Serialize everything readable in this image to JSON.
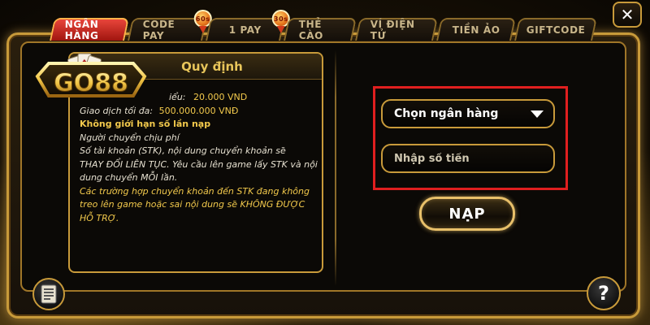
{
  "tabs": [
    {
      "label": "NGÂN HÀNG",
      "active": true
    },
    {
      "label": "CODE PAY",
      "badge": "60s"
    },
    {
      "label": "1 PAY",
      "badge": "30s"
    },
    {
      "label": "THẺ CÀO"
    },
    {
      "label": "VÍ ĐIỆN TỬ"
    },
    {
      "label": "TIỀN ẢO"
    },
    {
      "label": "GIFTCODE"
    }
  ],
  "close_label": "✕",
  "logo_text": "GO88",
  "rules": {
    "title": "Quy định",
    "min_suffix": "iểu:",
    "min_value": "20.000 VND",
    "max_label": "Giao dịch tối đa:",
    "max_value": "500.000.000 VNĐ",
    "unlimited": "Không giới hạn số  lần nạp",
    "fee": "Người chuyển chịu phí",
    "line1": "Số tài khoản (STK), nội dung chuyển khoản sẽ",
    "line2": "THAY ĐỔI LIÊN TỤC. Yêu cầu lên game lấy STK và nội",
    "line3": "dung chuyển MỖI lần.",
    "line4": "Các trường hợp chuyển khoản đến STK đang không",
    "line5": "treo lên game hoặc sai nội dung sẽ KHÔNG ĐƯỢC",
    "line6": "HỖ TRỢ."
  },
  "form": {
    "bank_select_label": "Chọn ngân hàng",
    "amount_placeholder": "Nhập số tiền",
    "submit_label": "NẠP"
  },
  "help_label": "?",
  "colors": {
    "accent_gold": "#c89a3a",
    "active_tab": "#d0302a",
    "highlight_border": "#e01f1f",
    "rule_highlight": "#f2c94c"
  }
}
